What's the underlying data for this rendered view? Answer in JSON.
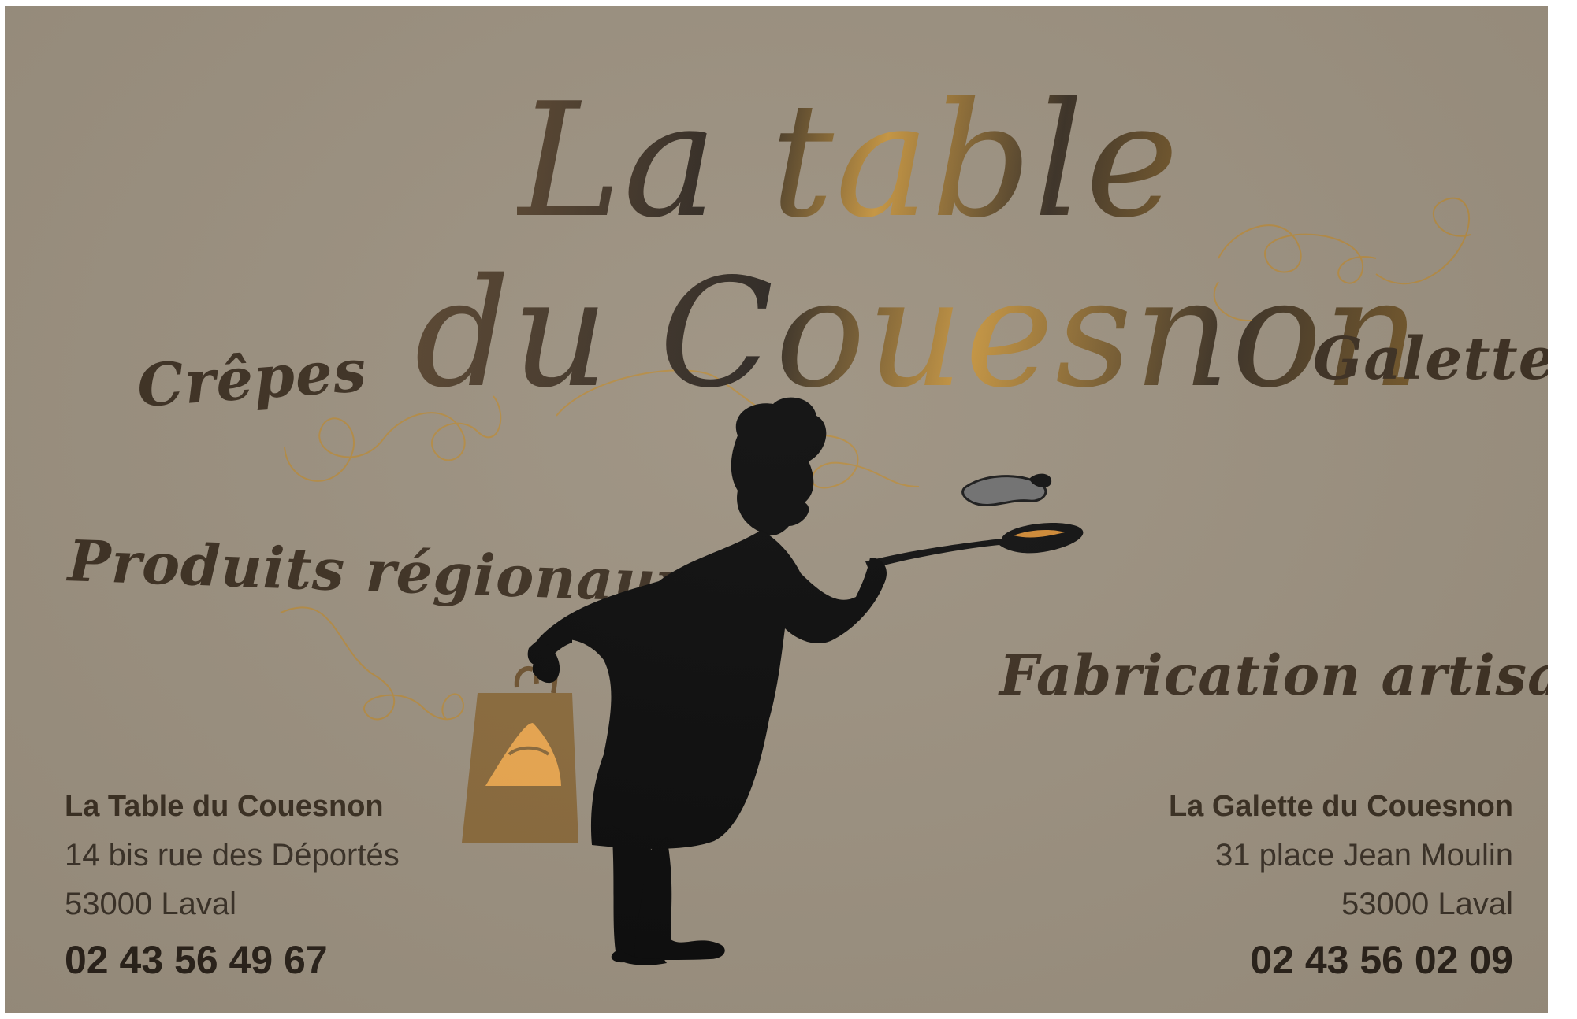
{
  "card": {
    "title_line1": "La table",
    "title_line2": "du Couesnon",
    "tags": {
      "crepes": "Crêpes",
      "galettes": "Galettes",
      "produits": "Produits régionaux",
      "fabrication": "Fabrication artisanale"
    },
    "left_address": {
      "name": "La Table du Couesnon",
      "street": "14 bis rue des Déportés",
      "city": "53000 Laval",
      "phone": "02 43 56 49 67"
    },
    "right_address": {
      "name": "La Galette du Couesnon",
      "street": "31 place Jean Moulin",
      "city": "53000 Laval",
      "phone": "02 43 56 02 09"
    }
  },
  "colors": {
    "background": "#9c9180",
    "text_dark": "#3e3123",
    "gold": "#c69540",
    "silhouette": "#0b0b0b",
    "bag": "#8a6a3c",
    "bag_logo": "#e9a64f"
  },
  "icons": {
    "chef": "chef-silhouette-icon",
    "bag": "shopping-bag-icon",
    "logo": "crepe-logo-icon"
  }
}
